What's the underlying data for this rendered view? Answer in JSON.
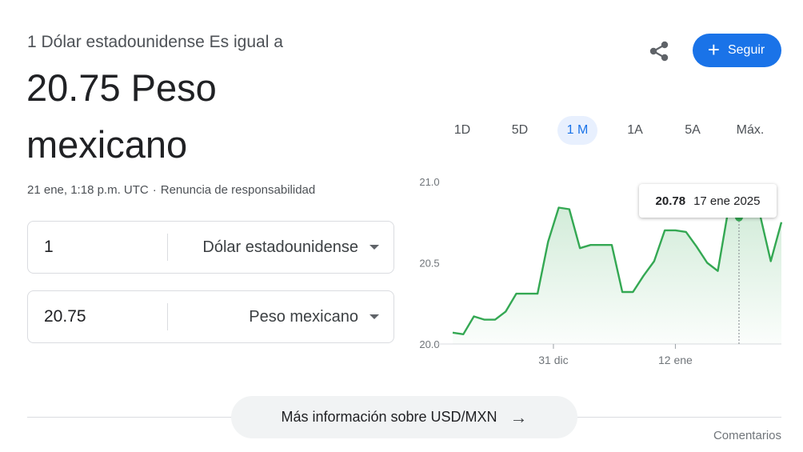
{
  "header": {
    "subtitle": "1 Dólar estadounidense Es igual a",
    "result_line1": "20.75 Peso",
    "result_line2": "mexicano",
    "timestamp": "21 ene, 1:18 p.m. UTC",
    "separator": "·",
    "disclaimer": "Renuncia de responsabilidad",
    "follow_label": "Seguir",
    "follow_icon": "plus-icon",
    "share_icon": "share-icon"
  },
  "converter": {
    "from": {
      "value": "1",
      "currency": "Dólar estadounidense"
    },
    "to": {
      "value": "20.75",
      "currency": "Peso mexicano"
    }
  },
  "ranges": [
    {
      "label": "1D",
      "active": false
    },
    {
      "label": "5D",
      "active": false
    },
    {
      "label": "1 M",
      "active": true
    },
    {
      "label": "1A",
      "active": false
    },
    {
      "label": "5A",
      "active": false
    },
    {
      "label": "Máx.",
      "active": false
    }
  ],
  "tooltip": {
    "value": "20.78",
    "date": "17 ene 2025"
  },
  "colors": {
    "accent": "#1a73e8",
    "line": "#34a853",
    "fill": "#e6f4ea"
  },
  "chart_data": {
    "type": "area",
    "ylim": [
      20.0,
      21.0
    ],
    "yticks": [
      "21.0",
      "20.5",
      "20.0"
    ],
    "ytick_values": [
      21.0,
      20.5,
      20.0
    ],
    "xticks": [
      {
        "label": "31 dic",
        "x": 9.5
      },
      {
        "label": "12 ene",
        "x": 21
      }
    ],
    "x": [
      0,
      1,
      2,
      3,
      4,
      5,
      6,
      7,
      8,
      9,
      10,
      11,
      12,
      13,
      14,
      15,
      16,
      17,
      18,
      19,
      20,
      21,
      22,
      23,
      24,
      25,
      26,
      27,
      28,
      29,
      30,
      31
    ],
    "values": [
      20.07,
      20.06,
      20.17,
      20.15,
      20.15,
      20.2,
      20.31,
      20.31,
      20.31,
      20.63,
      20.84,
      20.83,
      20.59,
      20.61,
      20.61,
      20.61,
      20.32,
      20.32,
      20.42,
      20.51,
      20.7,
      20.7,
      20.69,
      20.6,
      20.5,
      20.45,
      20.83,
      20.78,
      20.82,
      20.79,
      20.51,
      20.75
    ],
    "highlight_x": 27,
    "grid": false
  },
  "footer": {
    "more_info": "Más información sobre USD/MXN",
    "arrow_icon": "arrow-right-icon",
    "feedback": "Comentarios"
  }
}
